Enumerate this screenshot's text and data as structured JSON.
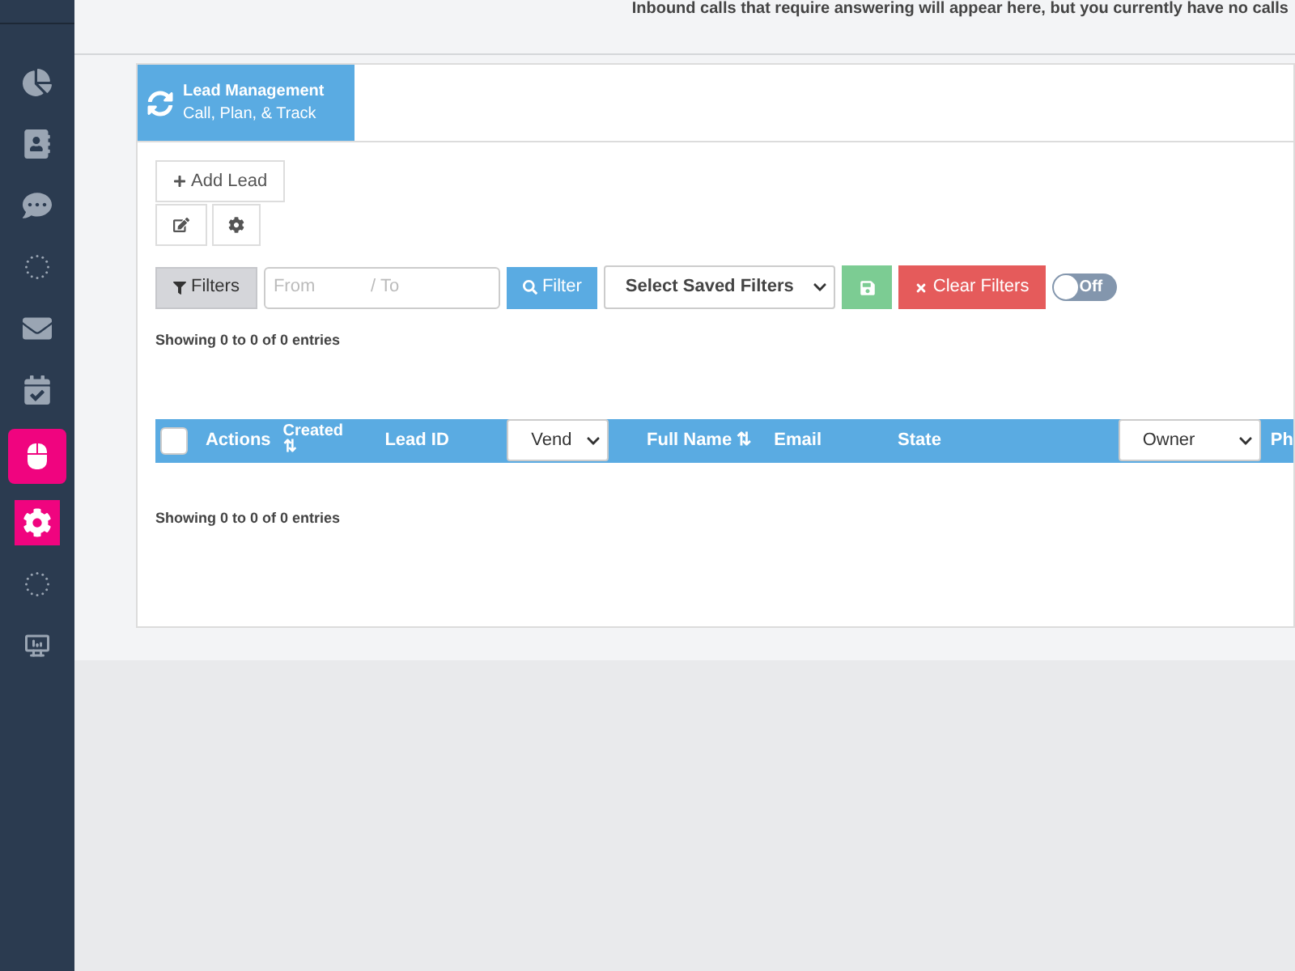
{
  "notice": "Inbound calls that require answering will appear here, but you currently have no calls",
  "sidebar": {
    "items": [
      {
        "kind": "chart",
        "selected": false
      },
      {
        "kind": "contacts",
        "selected": false
      },
      {
        "kind": "chat",
        "selected": false
      },
      {
        "kind": "network",
        "selected": false
      },
      {
        "kind": "mail",
        "selected": false
      },
      {
        "kind": "tasks",
        "selected": false
      },
      {
        "kind": "settings",
        "selected": true
      },
      {
        "kind": "network",
        "selected": false
      },
      {
        "kind": "monitor",
        "selected": false
      }
    ]
  },
  "module": {
    "title": "Lead Management",
    "subtitle": "Call, Plan, & Track"
  },
  "add_button": "Add Lead",
  "filters": {
    "filters_button": "Filters",
    "from_placeholder": "From",
    "separator": "/",
    "to_placeholder": "To",
    "filter_button": "Filter",
    "saved_select": "Select Saved Filters",
    "clear_button": "Clear Filters",
    "toggle": {
      "label": "Off",
      "on": false
    }
  },
  "info_top": "Showing 0 to 0 of 0 entries",
  "table": {
    "columns": [
      {
        "kind": "checkbox",
        "checked": false
      },
      {
        "kind": "text",
        "label": "Actions"
      },
      {
        "kind": "sortable_stacked",
        "label": "Created",
        "sort": "⇅"
      },
      {
        "kind": "text",
        "label": "Lead ID"
      },
      {
        "kind": "select",
        "label": "Vend"
      },
      {
        "kind": "sortable",
        "label": "Full Name",
        "sort": "⇅"
      },
      {
        "kind": "text",
        "label": "Email"
      },
      {
        "kind": "text",
        "label": "State"
      },
      {
        "kind": "select",
        "label": "Owner"
      },
      {
        "kind": "text",
        "label": "Ph"
      }
    ]
  },
  "info_bottom": "Showing 0 to 0 of 0 entries"
}
